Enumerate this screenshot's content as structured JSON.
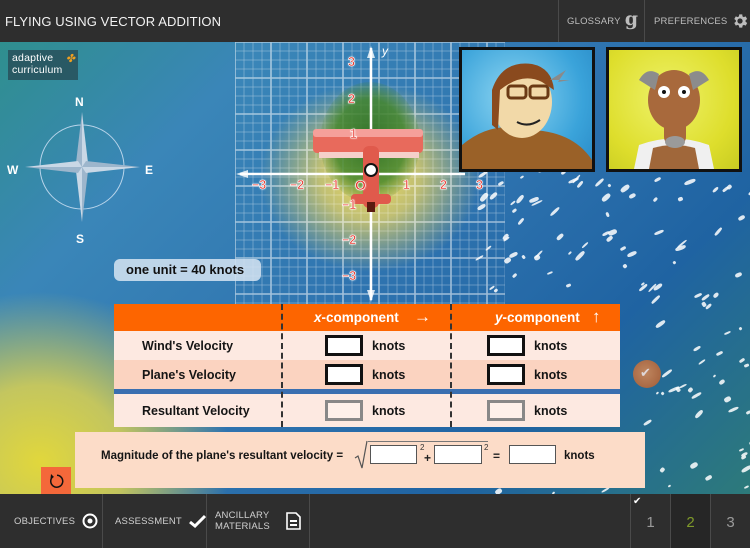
{
  "header": {
    "title": "FLYING USING VECTOR ADDITION",
    "glossary_label": "GLOSSARY",
    "glossary_icon": "g-glyph-icon",
    "glossary_glyph": "g",
    "preferences_label": "PREFERENCES",
    "preferences_icon": "gear-icon"
  },
  "logo": {
    "line1": "adaptive",
    "line2": "curriculum",
    "puzzle_glyph": "✤"
  },
  "compass": {
    "north": "N",
    "south": "S",
    "east": "E",
    "west": "W"
  },
  "graph": {
    "y_axis_label": "y",
    "origin_label": "O",
    "x_ticks": [
      "−3",
      "−2",
      "−1",
      "1",
      "2",
      "3"
    ],
    "y_ticks_positive": [
      "3",
      "2",
      "1"
    ],
    "y_ticks_negative": [
      "−1",
      "−2",
      "−3"
    ]
  },
  "characters": [
    {
      "name": "pilot",
      "bg_color": "#3aa3da"
    },
    {
      "name": "mechanic",
      "bg_color": "#dede2c"
    }
  ],
  "scale_label": "one unit  =  40 knots",
  "table": {
    "header_x_var": "x",
    "header_x_rest": "-component",
    "header_y_var": "y",
    "header_y_rest": "-component",
    "arrow_right": "→",
    "arrow_up": "↑",
    "rows": [
      {
        "label": "Wind's Velocity",
        "x_value": "",
        "y_value": "",
        "unit": "knots"
      },
      {
        "label": "Plane's Velocity",
        "x_value": "",
        "y_value": "",
        "unit": "knots"
      },
      {
        "label": "Resultant Velocity",
        "x_value": "",
        "y_value": "",
        "unit": "knots"
      }
    ],
    "header_color": "#fd6500"
  },
  "help_check_glyph": "✔",
  "magnitude": {
    "label": "Magnitude of the plane's resultant velocity =",
    "superscript": "2",
    "plus": "+",
    "equals": "=",
    "unit": "knots",
    "term1": "",
    "term2": "",
    "result": ""
  },
  "footer": {
    "objectives_label": "OBJECTIVES",
    "assessment_label": "ASSESSMENT",
    "ancillary_label_line1": "ANCILLARY",
    "ancillary_label_line2": "MATERIALS",
    "pages": [
      {
        "label": "1",
        "completed": true
      },
      {
        "label": "2",
        "current": true
      },
      {
        "label": "3"
      }
    ],
    "completed_glyph": "✔",
    "current_page_color": "#7f9a2a"
  },
  "accent_color": "#f4683a"
}
